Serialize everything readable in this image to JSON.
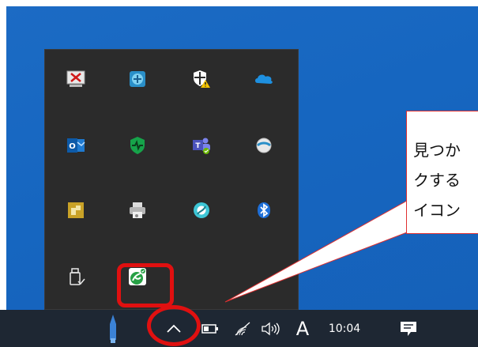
{
  "tray_overflow": {
    "icons": [
      {
        "name": "remote-desktop-icon"
      },
      {
        "name": "network-monitor-icon"
      },
      {
        "name": "security-alert-icon"
      },
      {
        "name": "onedrive-icon"
      },
      {
        "name": "outlook-icon"
      },
      {
        "name": "health-monitor-icon"
      },
      {
        "name": "teams-icon"
      },
      {
        "name": "cloud-globe-icon"
      },
      {
        "name": "sticky-app-icon"
      },
      {
        "name": "printer-icon"
      },
      {
        "name": "teal-sync-icon"
      },
      {
        "name": "bluetooth-icon"
      },
      {
        "name": "usb-drive-icon"
      },
      {
        "name": "green-check-app-icon"
      }
    ]
  },
  "taskbar": {
    "clock": "10:04",
    "ime_mode": "A",
    "icons": [
      "pen-icon",
      "show-hidden-icons-chevron",
      "battery-icon",
      "wifi-icon",
      "speaker-icon",
      "notification-icon"
    ]
  },
  "callout": {
    "lines": [
      "見つか",
      "クする",
      "イコン"
    ]
  },
  "colors": {
    "desktop": "#1666c0",
    "taskbar": "#1e2733",
    "flyout": "#2b2b2b",
    "annotation_red": "#e01010"
  }
}
